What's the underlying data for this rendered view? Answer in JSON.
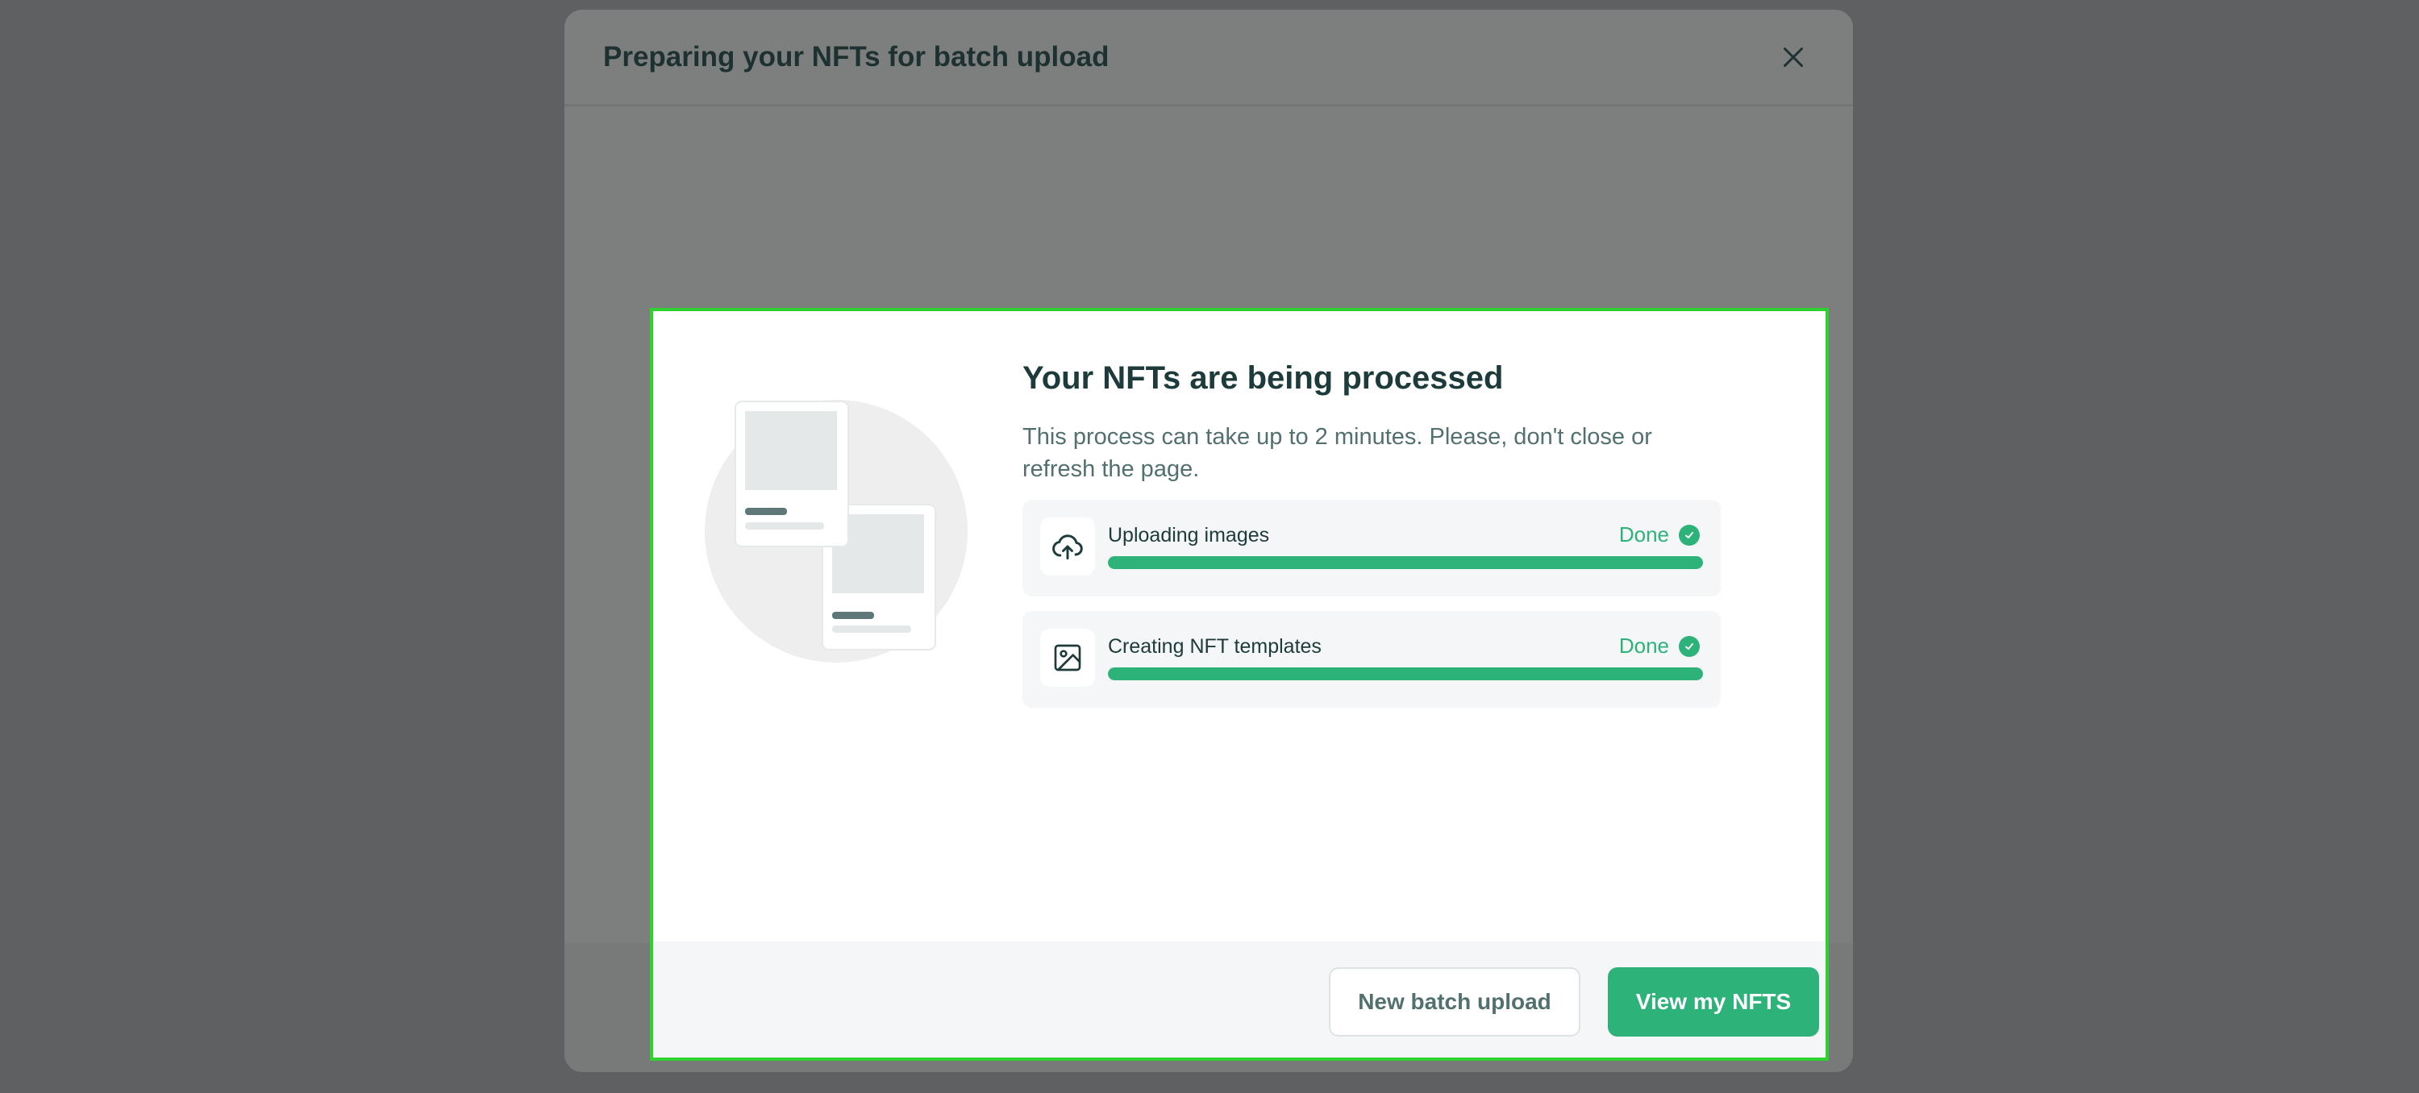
{
  "background_modal": {
    "title": "Preparing your NFTs for batch upload",
    "close_icon": "close-icon"
  },
  "dialog": {
    "title": "Your NFTs are being processed",
    "description": "This process can take up to 2 minutes. Please, don't close or refresh the page.",
    "tasks": [
      {
        "label": "Uploading images",
        "status": "Done",
        "icon": "cloud-upload-icon",
        "progress": 1.0
      },
      {
        "label": "Creating NFT templates",
        "status": "Done",
        "icon": "image-icon",
        "progress": 1.0
      }
    ],
    "buttons": {
      "secondary": "New batch upload",
      "primary": "View my NFTS"
    }
  },
  "colors": {
    "accent": "#2db27a",
    "highlight_border": "#2ed22e",
    "overlay": "#5f6062"
  }
}
